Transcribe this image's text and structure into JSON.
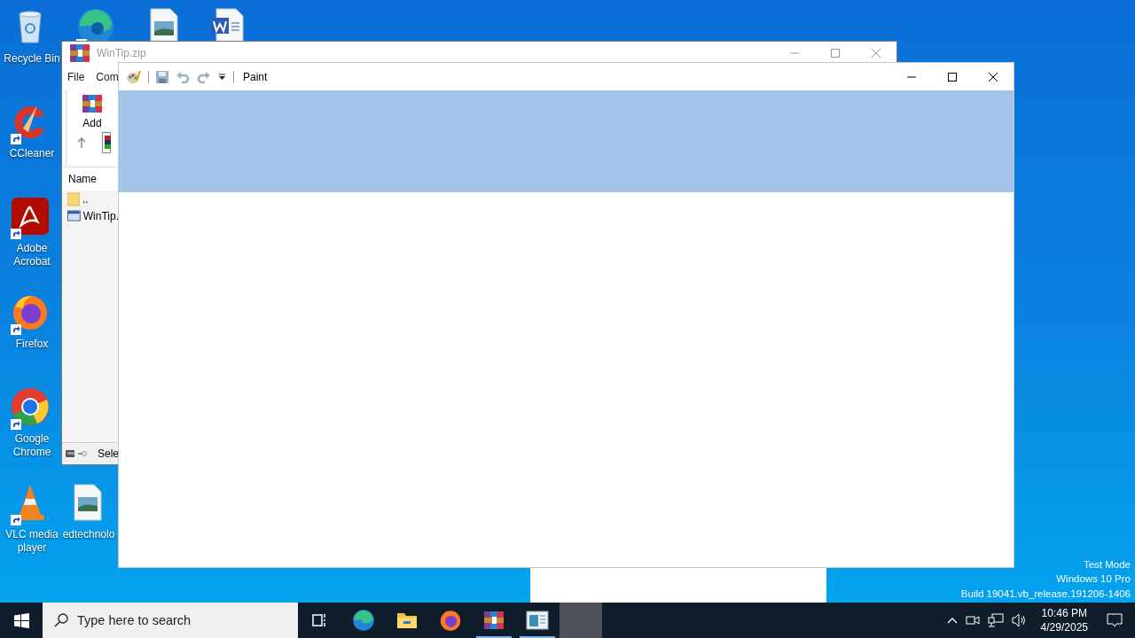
{
  "desktop_icons": [
    {
      "kind": "recycle",
      "label": "Recycle Bin",
      "shortcut": false
    },
    {
      "kind": "edge",
      "shortcut": true
    },
    {
      "kind": "image",
      "shortcut": false
    },
    {
      "kind": "word",
      "shortcut": false
    },
    {
      "kind": "ccleaner",
      "label": "CCleaner",
      "shortcut": true
    },
    {
      "kind": "acrobat",
      "label": "Adobe Acrobat",
      "shortcut": true
    },
    {
      "kind": "firefox",
      "label": "Firefox",
      "shortcut": true
    },
    {
      "kind": "chrome",
      "label": "Google Chrome",
      "shortcut": true
    },
    {
      "kind": "vlc",
      "label": "VLC media player",
      "shortcut": true
    },
    {
      "kind": "image",
      "label": "edtechnolo",
      "shortcut": false
    }
  ],
  "archive_window": {
    "title": "WinTip.zip",
    "menu": [
      "File",
      "Com"
    ],
    "toolbar": [
      {
        "label": "Add"
      }
    ],
    "columns": [
      "Name"
    ],
    "rows": [
      {
        "kind": "folder",
        "name": ".."
      },
      {
        "kind": "file",
        "name": "WinTip."
      }
    ],
    "status": "Sele"
  },
  "paint_window": {
    "title": "Paint"
  },
  "system_text": [
    "Test Mode",
    "Windows 10 Pro",
    "Build 19041.vb_release.191206-1406"
  ],
  "taskbar": {
    "search": {
      "placeholder": "Type here to search"
    },
    "apps": [
      {
        "kind": "taskview",
        "running": false,
        "selected": false
      },
      {
        "kind": "edge",
        "running": false,
        "selected": false
      },
      {
        "kind": "explorer",
        "running": false,
        "selected": false
      },
      {
        "kind": "firefox",
        "running": false,
        "selected": false
      },
      {
        "kind": "winrar",
        "running": true,
        "selected": false
      },
      {
        "kind": "paint",
        "running": true,
        "selected": false
      },
      {
        "kind": "blank",
        "running": false,
        "selected": true
      }
    ],
    "time": "10:46 PM",
    "date": "4/29/2025"
  }
}
